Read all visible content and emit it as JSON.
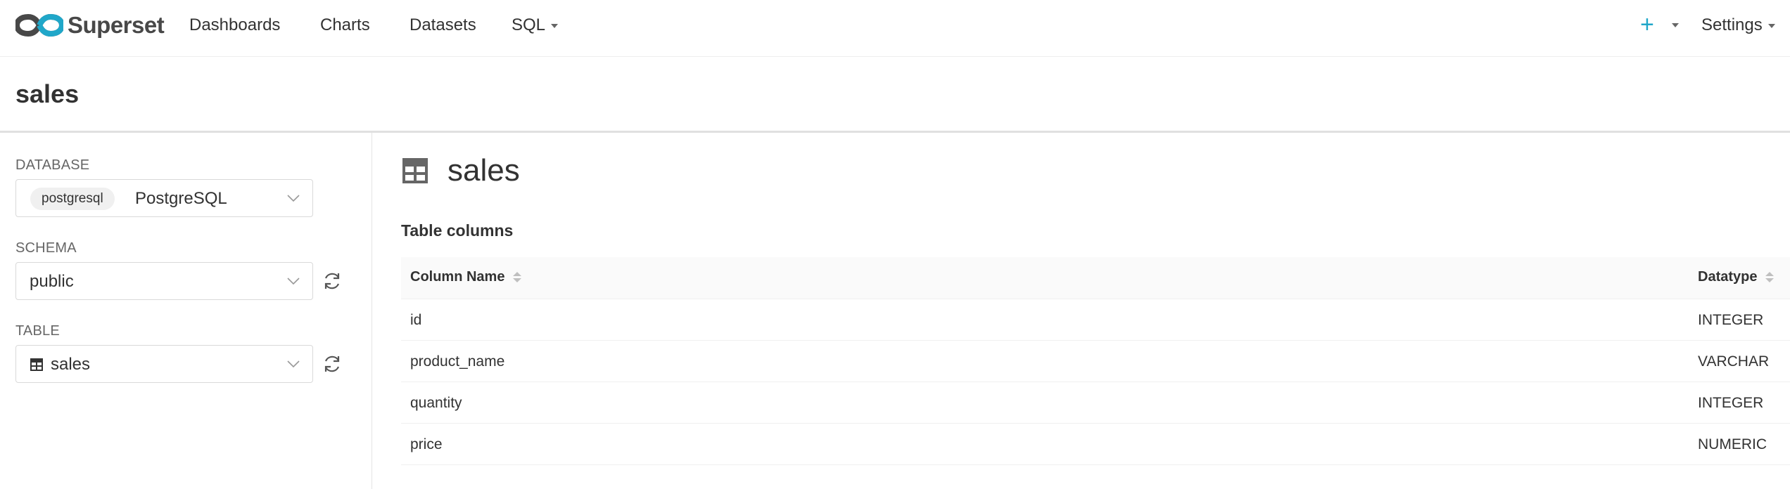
{
  "nav": {
    "brand": "Superset",
    "items": [
      "Dashboards",
      "Charts",
      "Datasets",
      "SQL"
    ],
    "plus": "+",
    "settings": "Settings"
  },
  "page": {
    "title": "sales"
  },
  "sidebar": {
    "database": {
      "label": "DATABASE",
      "tag": "postgresql",
      "value": "PostgreSQL"
    },
    "schema": {
      "label": "SCHEMA",
      "value": "public"
    },
    "table": {
      "label": "TABLE",
      "value": "sales"
    }
  },
  "main": {
    "title": "sales",
    "section_title": "Table columns",
    "columns": {
      "name": "Column Name",
      "type": "Datatype"
    },
    "rows": [
      {
        "name": "id",
        "type": "INTEGER"
      },
      {
        "name": "product_name",
        "type": "VARCHAR"
      },
      {
        "name": "quantity",
        "type": "INTEGER"
      },
      {
        "name": "price",
        "type": "NUMERIC"
      }
    ]
  },
  "colors": {
    "accent": "#20a7c9",
    "logo_dark": "#484848"
  }
}
